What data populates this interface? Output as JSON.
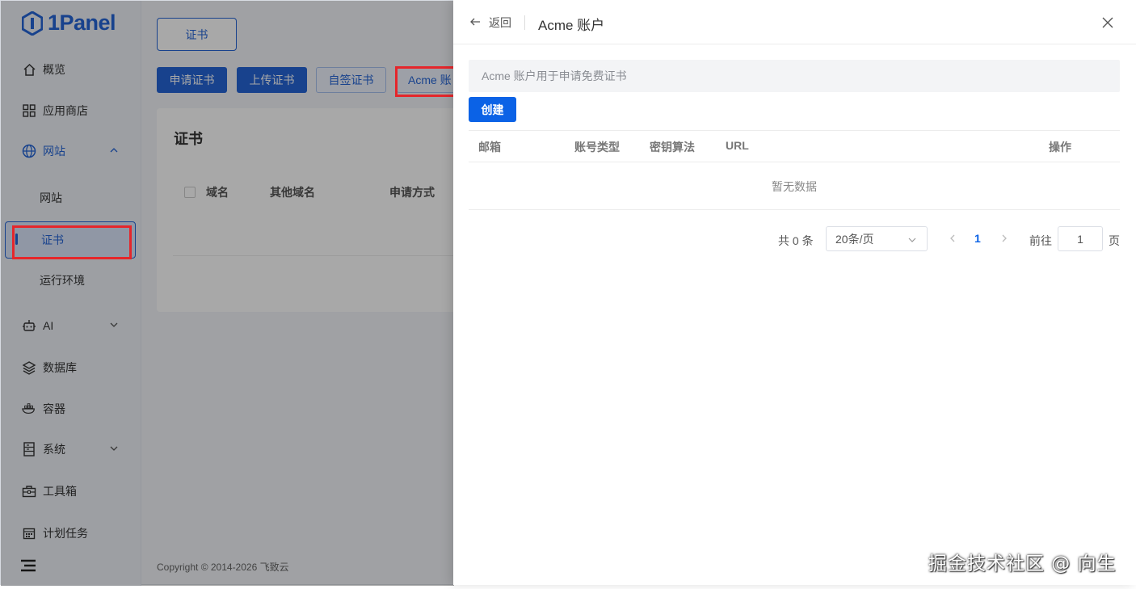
{
  "brand": {
    "logo_text": "1Panel"
  },
  "sidebar": {
    "items": [
      {
        "label": "概览",
        "icon": "home-icon"
      },
      {
        "label": "应用商店",
        "icon": "grid-icon"
      },
      {
        "label": "网站",
        "icon": "globe-icon",
        "expanded": true
      },
      {
        "label": "AI",
        "icon": "robot-icon"
      },
      {
        "label": "数据库",
        "icon": "layers-icon"
      },
      {
        "label": "容器",
        "icon": "container-icon"
      },
      {
        "label": "系统",
        "icon": "server-icon"
      },
      {
        "label": "工具箱",
        "icon": "toolbox-icon"
      },
      {
        "label": "计划任务",
        "icon": "calendar-icon"
      }
    ],
    "subitems": [
      "网站",
      "证书",
      "运行环境"
    ],
    "selected_subitem": "证书"
  },
  "main": {
    "tab": "证书",
    "toolbar": {
      "apply_cert": "申请证书",
      "upload_cert": "上传证书",
      "self_signed": "自签证书",
      "acme_account": "Acme 账"
    },
    "card": {
      "title": "证书",
      "columns": [
        "域名",
        "其他域名",
        "申请方式"
      ]
    },
    "footer": "Copyright © 2014-2026 飞致云"
  },
  "drawer": {
    "back_label": "返回",
    "title": "Acme 账户",
    "notice": "Acme 账户用于申请免费证书",
    "create_label": "创建",
    "columns": [
      "邮箱",
      "账号类型",
      "密钥算法",
      "URL",
      "操作"
    ],
    "empty_text": "暂无数据",
    "pagination": {
      "total": "共 0 条",
      "page_size": "20条/页",
      "current_page": "1",
      "goto_label": "前往",
      "goto_value": "1",
      "page_unit": "页"
    }
  },
  "watermark": "掘金技术社区 @ 向生",
  "colors": {
    "accent": "#2565d6",
    "primary_button": "#0b62e6",
    "highlight": "#e5262b"
  }
}
